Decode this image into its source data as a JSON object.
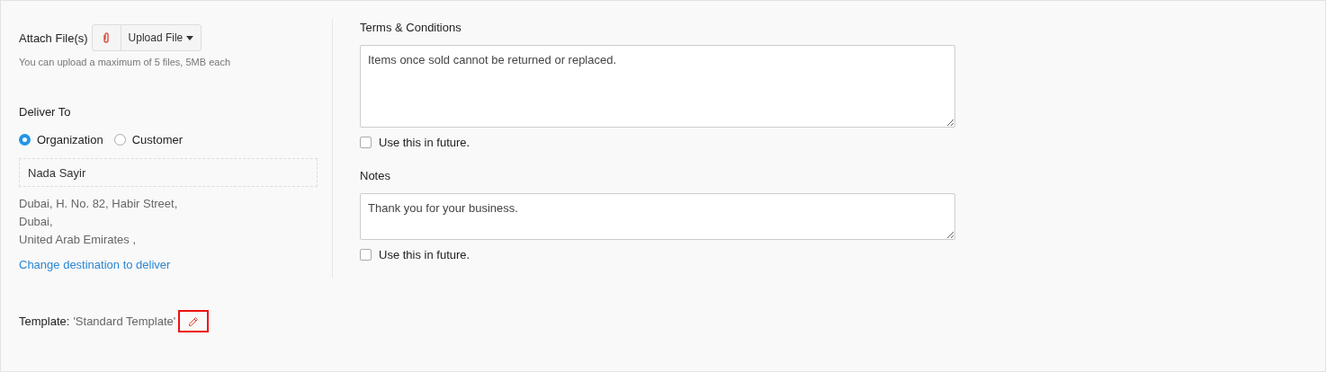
{
  "attach": {
    "label": "Attach File(s)",
    "button": "Upload File",
    "hint": "You can upload a maximum of 5 files, 5MB each"
  },
  "deliver": {
    "label": "Deliver To",
    "options": [
      {
        "label": "Organization",
        "selected": true
      },
      {
        "label": "Customer",
        "selected": false
      }
    ],
    "name": "Nada Sayir",
    "address": [
      "Dubai, H. No. 82, Habir Street,",
      "Dubai,",
      "United Arab Emirates ,"
    ],
    "link": "Change destination to deliver"
  },
  "template": {
    "label": "Template:",
    "value": "'Standard Template'",
    "highlighted": true
  },
  "terms": {
    "label": "Terms & Conditions",
    "value": "Items once sold cannot be returned or replaced.",
    "checkbox": {
      "label": "Use this in future.",
      "checked": false
    }
  },
  "notes": {
    "label": "Notes",
    "value": "Thank you for your business.",
    "checkbox": {
      "label": "Use this in future.",
      "checked": false
    }
  }
}
